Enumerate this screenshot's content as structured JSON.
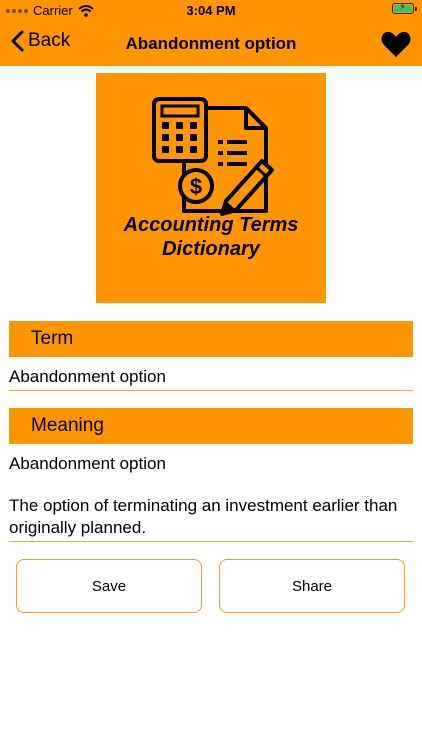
{
  "status_bar": {
    "carrier": "Carrier",
    "time": "3:04 PM",
    "battery_color": "#34c759"
  },
  "nav": {
    "back_label": "Back",
    "title": "Abandonment option",
    "favorite_icon": "heart-icon"
  },
  "logo": {
    "line1": "Accounting Terms",
    "line2": "Dictionary",
    "icons": [
      "calculator-icon",
      "document-icon",
      "dollar-coin-icon",
      "pencil-icon"
    ]
  },
  "term": {
    "header": "Term",
    "value": "Abandonment option"
  },
  "meaning": {
    "header": "Meaning",
    "line1": "Abandonment option",
    "line2": "The option of terminating an investment earlier than originally planned."
  },
  "actions": {
    "save_label": "Save",
    "share_label": "Share"
  },
  "colors": {
    "accent": "#FF9500",
    "divider": "#F0B040",
    "button_border": "#F0A030"
  }
}
